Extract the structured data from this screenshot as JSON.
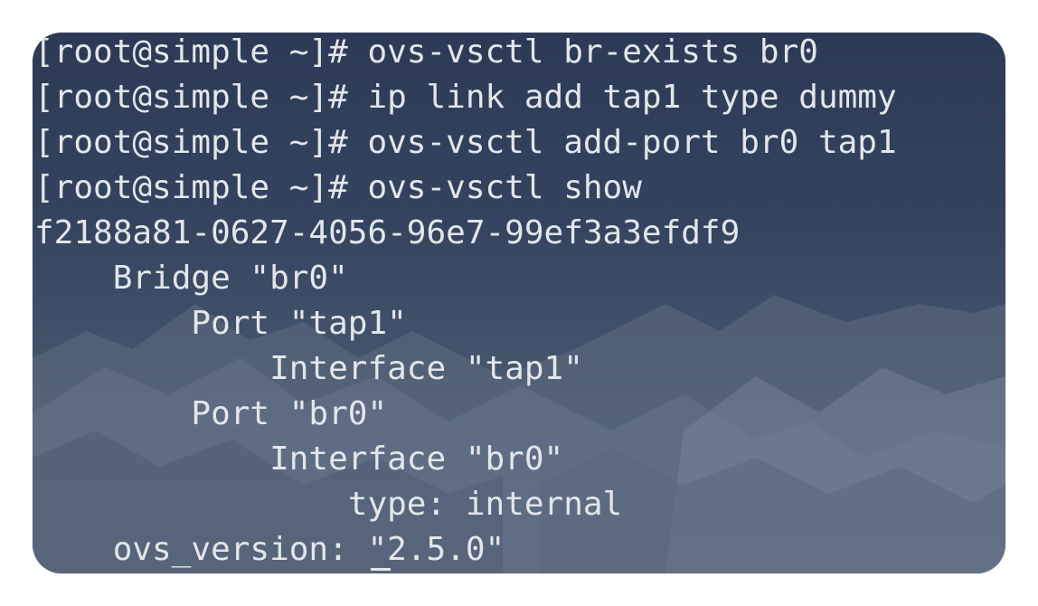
{
  "terminal": {
    "lines": [
      "[root@simple ~]# ovs-vsctl br-exists br0",
      "[root@simple ~]# ip link add tap1 type dummy",
      "[root@simple ~]# ovs-vsctl add-port br0 tap1",
      "[root@simple ~]# ovs-vsctl show",
      "f2188a81-0627-4056-96e7-99ef3a3efdf9",
      "    Bridge \"br0\"",
      "        Port \"tap1\"",
      "            Interface \"tap1\"",
      "        Port \"br0\"",
      "            Interface \"br0\"",
      "                type: internal",
      "    ovs_version: \"2.5.0\""
    ]
  },
  "colors": {
    "text": "#e3e6ea",
    "background_top": "#2c3a55",
    "background_bottom": "#56657a"
  }
}
